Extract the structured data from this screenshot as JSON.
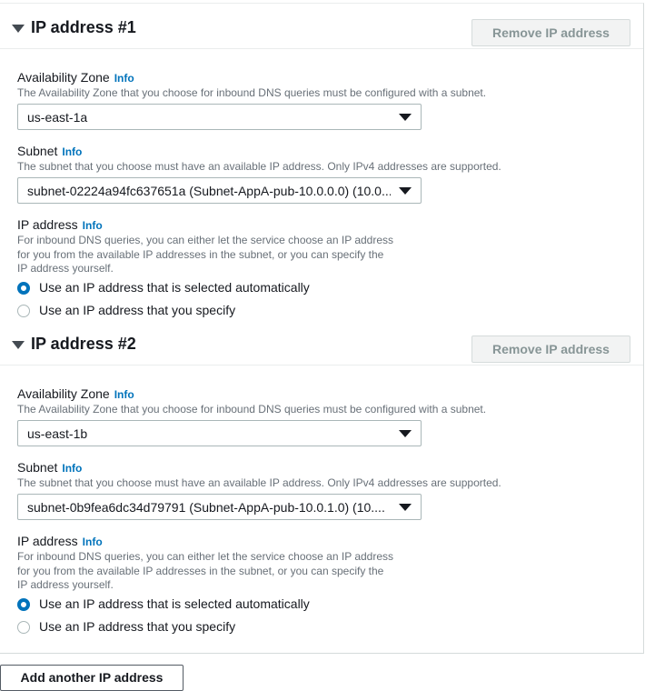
{
  "info_label": "Info",
  "sections": [
    {
      "title": "IP address #1",
      "remove_label": "Remove IP address",
      "az": {
        "label": "Availability Zone",
        "description": "The Availability Zone that you choose for inbound DNS queries must be configured with a subnet.",
        "value": "us-east-1a"
      },
      "subnet": {
        "label": "Subnet",
        "description": "The subnet that you choose must have an available IP address. Only IPv4 addresses are supported.",
        "value": "subnet-02224a94fc637651a (Subnet-AppA-pub-10.0.0.0) (10.0..."
      },
      "ip": {
        "label": "IP address",
        "description_lines": [
          "For inbound DNS queries, you can either let the service choose an IP address",
          "for you from the available IP addresses in the subnet, or you can specify the",
          "IP address yourself."
        ],
        "options": [
          {
            "label": "Use an IP address that is selected automatically",
            "selected": true
          },
          {
            "label": "Use an IP address that you specify",
            "selected": false
          }
        ]
      }
    },
    {
      "title": "IP address #2",
      "remove_label": "Remove IP address",
      "az": {
        "label": "Availability Zone",
        "description": "The Availability Zone that you choose for inbound DNS queries must be configured with a subnet.",
        "value": "us-east-1b"
      },
      "subnet": {
        "label": "Subnet",
        "description": "The subnet that you choose must have an available IP address. Only IPv4 addresses are supported.",
        "value": "subnet-0b9fea6dc34d79791 (Subnet-AppA-pub-10.0.1.0) (10...."
      },
      "ip": {
        "label": "IP address",
        "description_lines": [
          "For inbound DNS queries, you can either let the service choose an IP address",
          "for you from the available IP addresses in the subnet, or you can specify the",
          "IP address yourself."
        ],
        "options": [
          {
            "label": "Use an IP address that is selected automatically",
            "selected": true
          },
          {
            "label": "Use an IP address that you specify",
            "selected": false
          }
        ]
      }
    }
  ],
  "add_button_label": "Add another IP address",
  "colors": {
    "info_link": "#0073bb",
    "radio_selected": "#0073bb",
    "disabled_text": "#879596"
  }
}
